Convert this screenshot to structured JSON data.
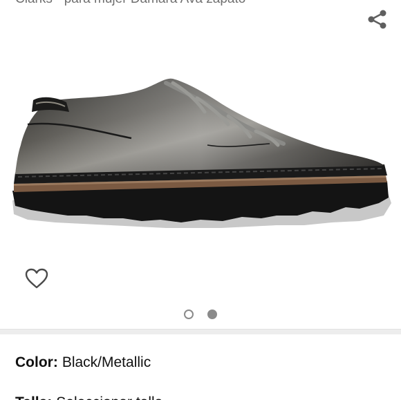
{
  "product": {
    "title": "Clarks - para mujer Damara Ava zapato"
  },
  "icons": {
    "share": "share-icon",
    "wishlist": "heart-outline-icon",
    "product_image": "shoe-image"
  },
  "carousel": {
    "total": 2,
    "active_index": 2
  },
  "variation": {
    "color_label": "Color:",
    "color_value": "Black/Metallic",
    "size_label": "Talla:",
    "size_value": "Seleccionar talla"
  },
  "colors": {
    "accent_gray": "#8a8a8a",
    "divider": "#ededed",
    "text": "#111111"
  }
}
